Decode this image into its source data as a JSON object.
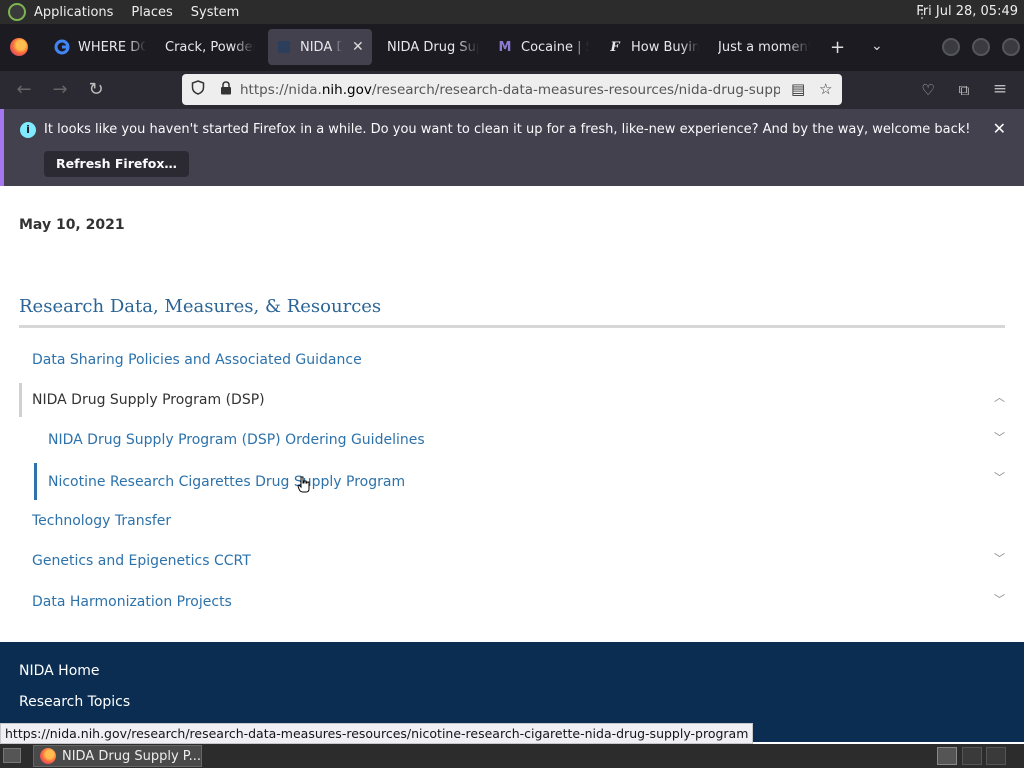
{
  "panel": {
    "menus": [
      "Applications",
      "Places",
      "System"
    ],
    "clock": "Fri Jul 28, 05:49"
  },
  "tabs": [
    {
      "title": "WHERE DO",
      "icon": "google-icon"
    },
    {
      "title": "Crack, Powder",
      "icon": "none"
    },
    {
      "title": "NIDA Dr",
      "icon": "nida-icon",
      "active": true
    },
    {
      "title": "NIDA Drug Sup",
      "icon": "none"
    },
    {
      "title": "Cocaine | S",
      "icon": "m-icon"
    },
    {
      "title": "How Buying",
      "icon": "f-icon"
    },
    {
      "title": "Just a moment",
      "icon": "none"
    }
  ],
  "urlbar": {
    "prefix": "https://nida.",
    "host": "nih.gov",
    "path": "/research/research-data-measures-resources/nida-drug-supply-pr"
  },
  "notification": {
    "message": "It looks like you haven't started Firefox in a while. Do you want to clean it up for a fresh, like-new experience? And by the way, welcome back!",
    "button": "Refresh Firefox…"
  },
  "page": {
    "date": "May 10, 2021",
    "section_title": "Research Data, Measures, & Resources",
    "nav_items": [
      {
        "label": "Data Sharing Policies and Associated Guidance",
        "chevron": false
      },
      {
        "label": "NIDA Drug Supply Program (DSP)",
        "chevron": "up",
        "current": true
      },
      {
        "label": "NIDA Drug Supply Program (DSP) Ordering Guidelines",
        "chevron": "down",
        "level": 2
      },
      {
        "label": "Nicotine Research Cigarettes Drug Supply Program",
        "chevron": "down",
        "level": 2,
        "active": true
      },
      {
        "label": "Technology Transfer",
        "chevron": false
      },
      {
        "label": "Genetics and Epigenetics CCRT",
        "chevron": "down"
      },
      {
        "label": "Data Harmonization Projects",
        "chevron": "down"
      }
    ]
  },
  "footer": {
    "links": [
      "NIDA Home",
      "Research Topics"
    ]
  },
  "status_url": "https://nida.nih.gov/research/research-data-measures-resources/nicotine-research-cigarette-nida-drug-supply-program",
  "taskbar": {
    "task_label": "NIDA Drug Supply P..."
  }
}
